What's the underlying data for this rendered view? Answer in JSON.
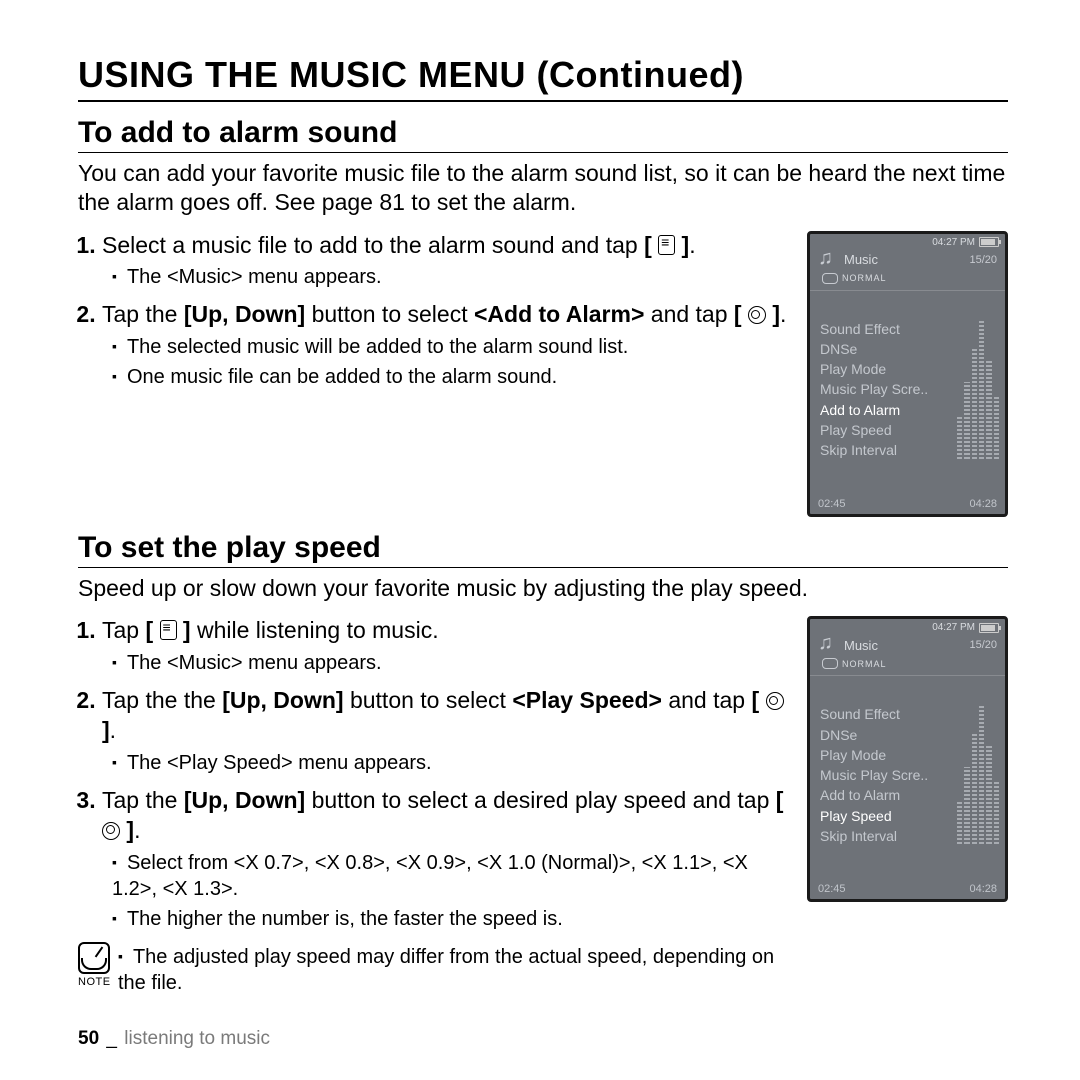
{
  "heading": "USING THE MUSIC MENU (Continued)",
  "section1": {
    "title": "To add to alarm sound",
    "intro": "You can add your favorite music file to the alarm sound list, so it can be heard the next time the alarm goes off. See page 81 to set the alarm.",
    "step1": "Select a music file to add to the alarm sound and tap ",
    "step1_bullet": "The <Music> menu appears.",
    "step2a": "Tap the ",
    "step2_bold1": "[Up, Down]",
    "step2b": " button to select ",
    "step2_bold2": "<Add to Alarm>",
    "step2c": " and tap ",
    "step2_bullet1": "The selected music will be added to the alarm sound list.",
    "step2_bullet2": "One music file can be added to the alarm sound."
  },
  "section2": {
    "title": "To set the play speed",
    "intro": "Speed up or slow down your favorite music by adjusting the play speed.",
    "step1a": "Tap ",
    "step1b": " while listening to music.",
    "step1_bullet": "The <Music> menu appears.",
    "step2a": "Tap the the ",
    "step2_bold1": "[Up, Down]",
    "step2b": " button to select ",
    "step2_bold2": "<Play Speed>",
    "step2c": " and tap ",
    "step2_bullet": "The <Play Speed> menu appears.",
    "step3a": "Tap the ",
    "step3_bold": "[Up, Down]",
    "step3b": " button to select a desired play speed and tap ",
    "step3_bullet1": "Select from <X 0.7>, <X 0.8>, <X 0.9>, <X 1.0 (Normal)>, <X 1.1>, <X 1.2>, <X 1.3>.",
    "step3_bullet2": "The higher the number is, the faster the speed is.",
    "note_label": "NOTE",
    "note_text": "The adjusted play speed may differ from the actual speed, depending on the file."
  },
  "device": {
    "time": "04:27 PM",
    "title": "Music",
    "count": "15/20",
    "mode": "NORMAL",
    "menu": [
      "Sound Effect",
      "DNSe",
      "Play Mode",
      "Music Play Scre..",
      "Add to Alarm",
      "Play Speed",
      "Skip Interval"
    ],
    "hl1": "Add to Alarm",
    "hl2": "Play Speed",
    "time_left": "02:45",
    "time_right": "04:28"
  },
  "footer": {
    "page": "50",
    "sep": "_",
    "section": "listening to music"
  }
}
